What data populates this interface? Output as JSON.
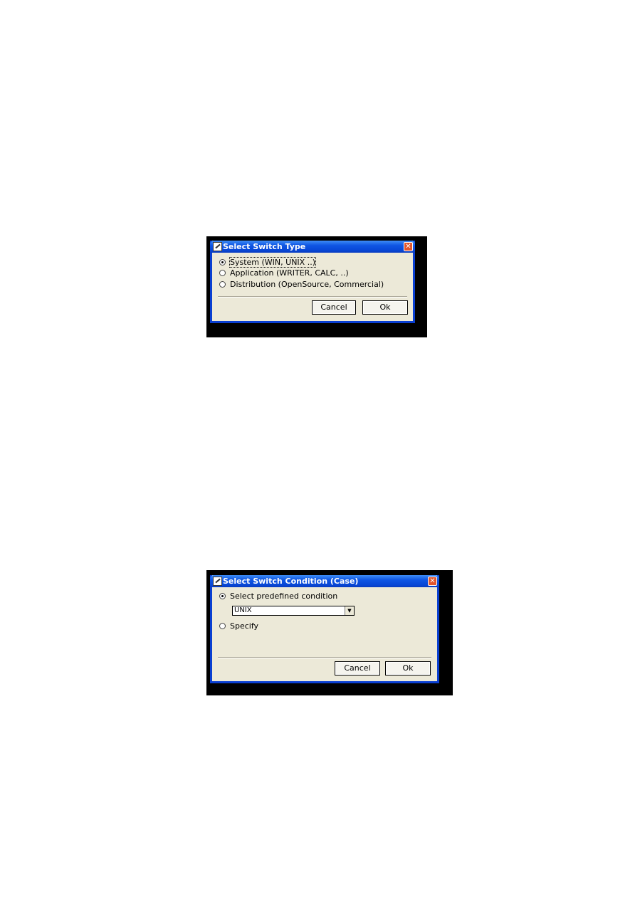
{
  "dialog1": {
    "title": "Select Switch Type",
    "options": [
      {
        "label": "System (WIN, UNIX ..)",
        "selected": true
      },
      {
        "label": "Application (WRITER, CALC, ..)",
        "selected": false
      },
      {
        "label": "Distribution (OpenSource, Commercial)",
        "selected": false
      }
    ],
    "cancel_label": "Cancel",
    "ok_label": "Ok"
  },
  "dialog2": {
    "title": "Select Switch Condition (Case)",
    "predefined_label": "Select predefined condition",
    "predefined_selected": true,
    "combo_value": "UNIX",
    "specify_label": "Specify",
    "cancel_label": "Cancel",
    "ok_label": "Ok"
  },
  "icons": {
    "app": "app-icon",
    "close": "close-icon",
    "dropdown": "chevron-down-icon"
  },
  "colors": {
    "titlebar": "#0a47d6",
    "dialog_bg": "#ece9d8",
    "close": "#e2552b"
  }
}
